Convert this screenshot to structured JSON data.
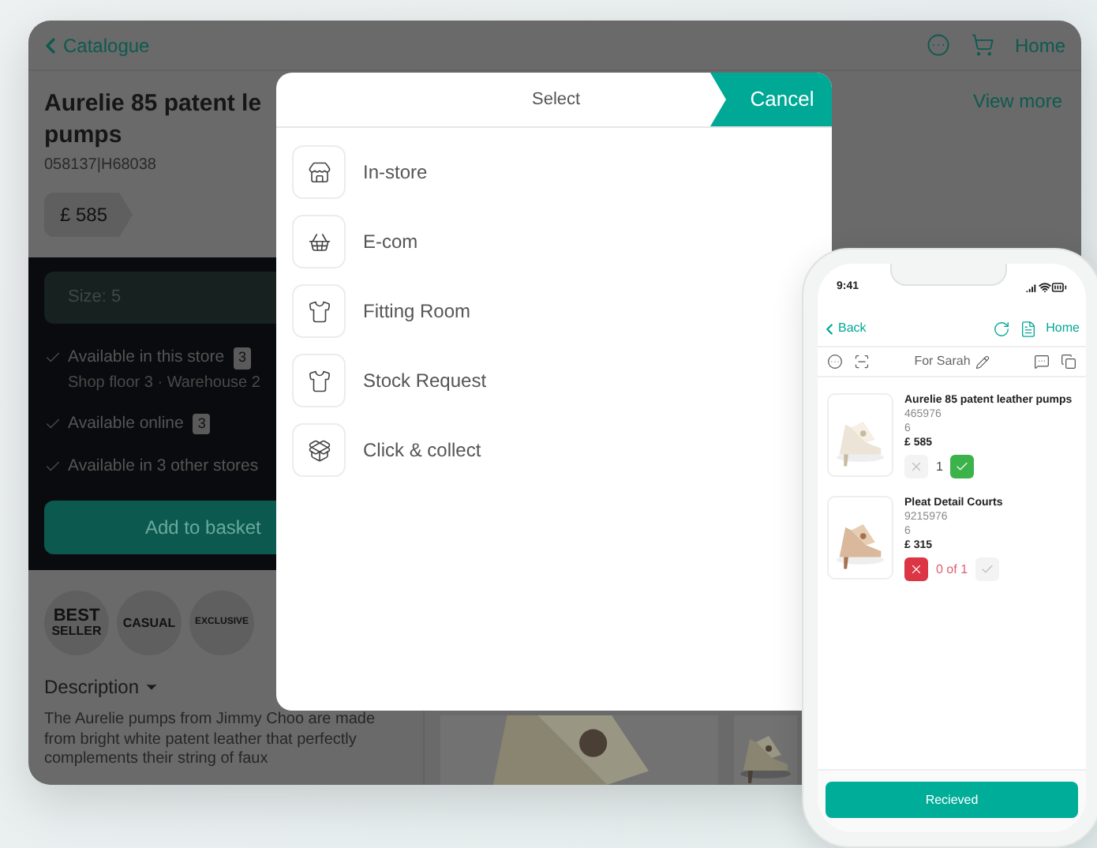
{
  "tablet": {
    "back_label": "Catalogue",
    "home_label": "Home",
    "view_more": "View more",
    "product": {
      "title_lines": [
        "Aurelie 85 patent le",
        "pumps"
      ],
      "code": "058137|H68038",
      "price": "£ 585",
      "size": "Size: 5",
      "availability": [
        {
          "label": "Available in this store",
          "count": "3",
          "detail": "Shop floor 3 · Warehouse 2"
        },
        {
          "label": "Available online",
          "count": "3"
        },
        {
          "label": "Available in 3 other stores"
        }
      ],
      "add_button": "Add to basket",
      "badges": [
        {
          "kind": "stacked",
          "lines": [
            "BEST",
            "SELLER"
          ]
        },
        {
          "kind": "plain",
          "lines": [
            "CASUAL"
          ]
        },
        {
          "kind": "small",
          "lines": [
            "EXCLUSIVE"
          ]
        }
      ],
      "description_heading": "Description",
      "description": "The Aurelie pumps from Jimmy Choo are made from bright white patent leather that perfectly complements their string of faux"
    }
  },
  "modal": {
    "title": "Select",
    "cancel": "Cancel",
    "options": [
      {
        "label": "In-store"
      },
      {
        "label": "E-com"
      },
      {
        "label": "Fitting Room"
      },
      {
        "label": "Stock Request"
      },
      {
        "label": "Click & collect"
      }
    ]
  },
  "phone": {
    "time": "9:41",
    "back": "Back",
    "home": "Home",
    "customer": "For Sarah",
    "items": [
      {
        "name": "Aurelie 85 patent leather pumps",
        "code": "465976",
        "size": "6",
        "price": "£ 585",
        "kind": "accepted",
        "quantity": "1"
      },
      {
        "name": "Pleat Detail Courts",
        "code": "9215976",
        "size": "6",
        "price": "£ 315",
        "kind": "rejected",
        "quantity": "0 of 1"
      }
    ],
    "button": "Recieved"
  }
}
